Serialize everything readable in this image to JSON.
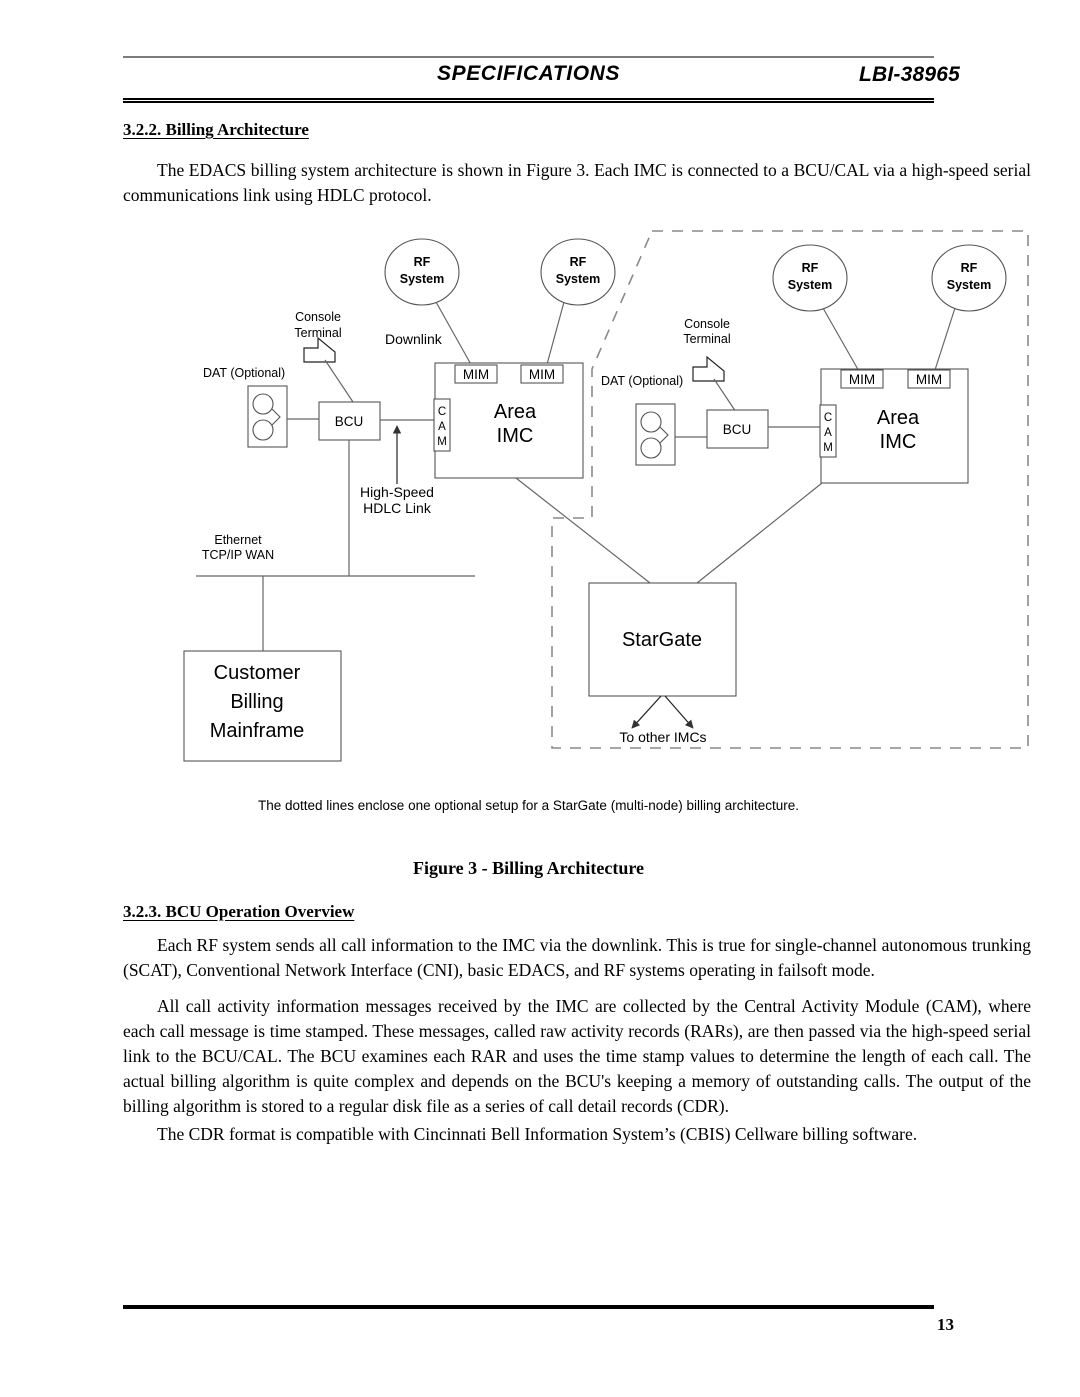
{
  "header": {
    "title": "SPECIFICATIONS",
    "doc_number": "LBI-38965"
  },
  "sections": {
    "s322_heading": "3.2.2.  Billing Architecture",
    "s322_para1": "The EDACS billing system architecture is shown in Figure 3.  Each IMC is connected to a BCU/CAL via a high-speed serial communications link using HDLC protocol.",
    "s323_heading": "3.2.3.  BCU Operation Overview",
    "s323_para1": "Each RF system sends all call information to the IMC via the downlink.  This is true for single-channel autonomous trunking (SCAT), Conventional Network Interface (CNI), basic EDACS, and RF systems operating in failsoft mode.",
    "s323_para2": "All call activity information messages received by the IMC are collected by the Central Activity Module (CAM), where each call message is time stamped.  These messages, called raw activity records (RARs), are then passed via the high-speed serial link to the BCU/CAL.  The BCU examines each RAR and uses the time stamp values to determine the length of each call.  The actual billing algorithm is quite complex and depends on the BCU's keeping a memory of outstanding calls.  The output of the billing algorithm is stored to a regular disk file as a series of call detail records (CDR).",
    "s323_para3": "The CDR format is compatible with Cincinnati Bell Information System’s (CBIS) Cellware billing software."
  },
  "figure": {
    "note": "The dotted lines enclose one optional setup for a StarGate (multi-node) billing architecture.",
    "caption": "Figure 3 - Billing Architecture"
  },
  "diagram": {
    "node_left": {
      "rf1_line1": "RF",
      "rf1_line2": "System",
      "rf2_line1": "RF",
      "rf2_line2": "System",
      "console_line1": "Console",
      "console_line2": "Terminal",
      "dat": "DAT (Optional)",
      "bcu": "BCU",
      "downlink": "Downlink",
      "mim1": "MIM",
      "mim2": "MIM",
      "cam_c": "C",
      "cam_a": "A",
      "cam_m": "M",
      "imc_line1": "Area",
      "imc_line2": "IMC",
      "hdlc_line1": "High-Speed",
      "hdlc_line2": "HDLC Link",
      "ethernet_line1": "Ethernet",
      "ethernet_line2": "TCP/IP WAN",
      "mainframe_line1": "Customer",
      "mainframe_line2": "Billing",
      "mainframe_line3": "Mainframe"
    },
    "node_right": {
      "rf1_line1": "RF",
      "rf1_line2": "System",
      "rf2_line1": "RF",
      "rf2_line2": "System",
      "console_line1": "Console",
      "console_line2": "Terminal",
      "dat": "DAT (Optional)",
      "bcu": "BCU",
      "mim1": "MIM",
      "mim2": "MIM",
      "cam_c": "C",
      "cam_a": "A",
      "cam_m": "M",
      "imc_line1": "Area",
      "imc_line2": "IMC"
    },
    "stargate": {
      "label": "StarGate",
      "to_other": "To other IMCs"
    },
    "colors": {
      "line": "#555555",
      "dashed_boundary": "#8a8a8a",
      "text": "#000000"
    }
  },
  "footer": {
    "page_number": "13"
  }
}
